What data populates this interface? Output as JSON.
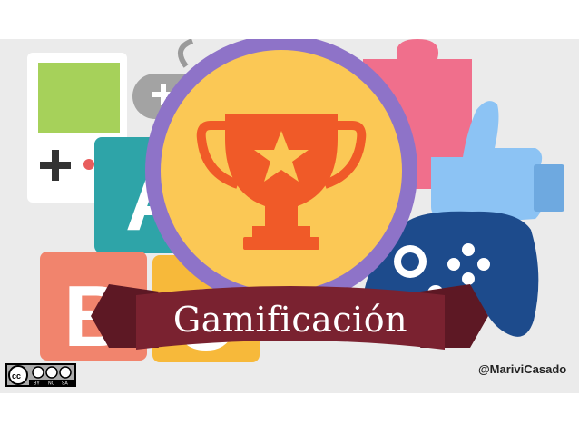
{
  "title": "Gamificación",
  "credit": "@MariviCasado",
  "license": {
    "badge": [
      "BY",
      "NC",
      "SA"
    ],
    "icons": [
      "cc-icon",
      "attribution-icon",
      "noncommercial-icon",
      "sharealike-icon"
    ]
  },
  "decorations": [
    "handheld-console-icon",
    "gamepad-icon",
    "puzzle-piece-icon",
    "thumbs-up-icon",
    "letter-block-a",
    "letter-block-b",
    "letter-block-c",
    "game-controller-icon",
    "trophy-badge",
    "ribbon-banner"
  ],
  "letter_blocks": {
    "a": "A",
    "b": "B",
    "c": "C"
  },
  "colors": {
    "background": "#ebebeb",
    "badge_ring": "#8e73c8",
    "badge_fill": "#fbc855",
    "trophy": "#f05a28",
    "ribbon": "#7a2230",
    "puzzle": "#f06f8c",
    "thumbs_up": "#8cc3f4",
    "controller": "#1d4b8c",
    "block_a": "#2ea4a8",
    "block_b": "#f1846d",
    "block_c": "#f7b93a",
    "handheld_screen": "#a6d15a"
  }
}
